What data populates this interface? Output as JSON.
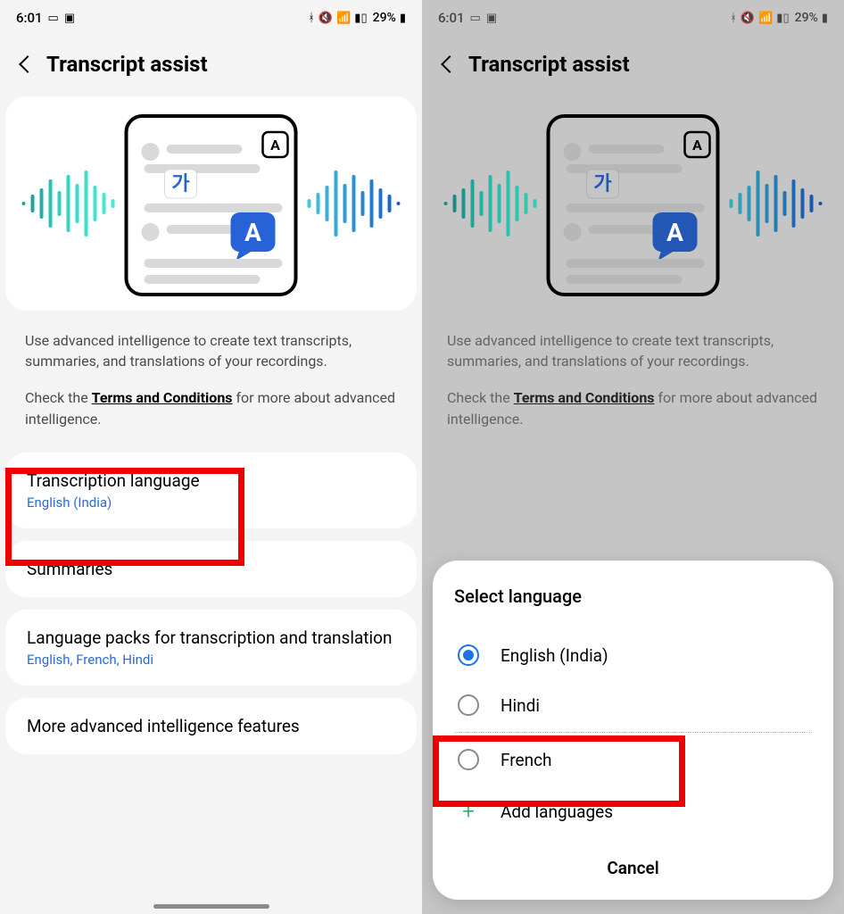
{
  "status": {
    "time": "6:01",
    "battery_pct": "29%"
  },
  "header": {
    "title": "Transcript assist"
  },
  "desc": {
    "line1_a": "Use advanced intelligence to create text transcripts, summaries, and translations of your recordings.",
    "line2_a": "Check the ",
    "terms": "Terms and Conditions",
    "line2_b": " for more about advanced intelligence."
  },
  "items": {
    "transcription": {
      "title": "Transcription language",
      "sub": "English (India)"
    },
    "summaries": {
      "title": "Summaries"
    },
    "packs": {
      "title": "Language packs for transcription and translation",
      "sub": "English, French, Hindi"
    },
    "more": {
      "title": "More advanced intelligence features"
    }
  },
  "sheet": {
    "title": "Select language",
    "options": {
      "en": "English (India)",
      "hi": "Hindi",
      "fr": "French"
    },
    "add": "Add languages",
    "cancel": "Cancel"
  },
  "illustration": {
    "ka": "가",
    "a": "A"
  }
}
